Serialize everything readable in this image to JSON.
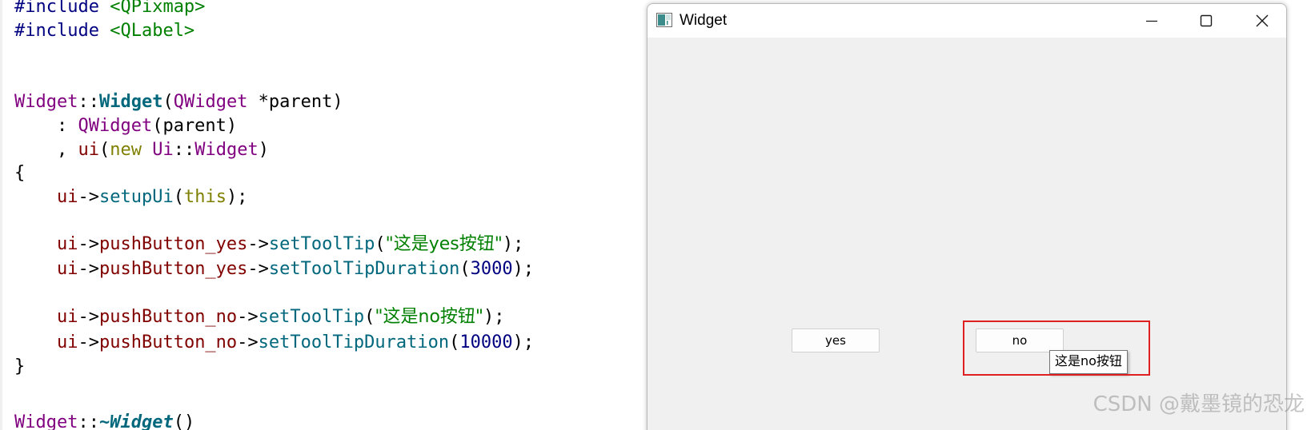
{
  "code": {
    "line1": {
      "directive": "#include",
      "target": "<QPixmap>"
    },
    "line2": {
      "directive": "#include",
      "target": "<QLabel>"
    },
    "ctor": {
      "cls": "Widget",
      "sep": "::",
      "name": "Widget",
      "open": "(",
      "param_type": "QWidget",
      "param": " *parent)"
    },
    "init1": {
      "prefix": "    : ",
      "base": "QWidget",
      "args": "(parent)"
    },
    "init2": {
      "prefix": "    , ",
      "member": "ui",
      "open": "(",
      "kw_new": "new",
      "sp": " ",
      "ns": "Ui",
      "sep": "::",
      "cls": "Widget",
      "close": ")"
    },
    "brace_open": "{",
    "setup": {
      "indent": "    ",
      "obj": "ui",
      "arrow": "->",
      "fn": "setupUi",
      "open": "(",
      "kw": "this",
      "close": ");"
    },
    "tip_yes": {
      "indent": "    ",
      "obj": "ui",
      "arrow1": "->",
      "member": "pushButton_yes",
      "arrow2": "->",
      "fn": "setToolTip",
      "open": "(",
      "str": "\"这是yes按钮\"",
      "close": ");"
    },
    "dur_yes": {
      "indent": "    ",
      "obj": "ui",
      "arrow1": "->",
      "member": "pushButton_yes",
      "arrow2": "->",
      "fn": "setToolTipDuration",
      "open": "(",
      "num": "3000",
      "close": ");"
    },
    "tip_no": {
      "indent": "    ",
      "obj": "ui",
      "arrow1": "->",
      "member": "pushButton_no",
      "arrow2": "->",
      "fn": "setToolTip",
      "open": "(",
      "str": "\"这是no按钮\"",
      "close": ");"
    },
    "dur_no": {
      "indent": "    ",
      "obj": "ui",
      "arrow1": "->",
      "member": "pushButton_no",
      "arrow2": "->",
      "fn": "setToolTipDuration",
      "open": "(",
      "num": "10000",
      "close": ");"
    },
    "brace_close": "}",
    "dtor": {
      "cls": "Widget",
      "sep": "::",
      "name": "~Widget",
      "tail": "()"
    }
  },
  "window": {
    "title": "Widget",
    "icon": "qt-window-icon",
    "controls": {
      "minimize": "minimize-icon",
      "maximize": "maximize-icon",
      "close": "close-icon"
    }
  },
  "buttons": {
    "yes_label": "yes",
    "no_label": "no"
  },
  "tooltip": {
    "text": "这是no按钮"
  },
  "watermark": "CSDN @戴墨镜的恐龙",
  "colors": {
    "highlight": "#e02020",
    "window_bg": "#f0f0f0"
  }
}
